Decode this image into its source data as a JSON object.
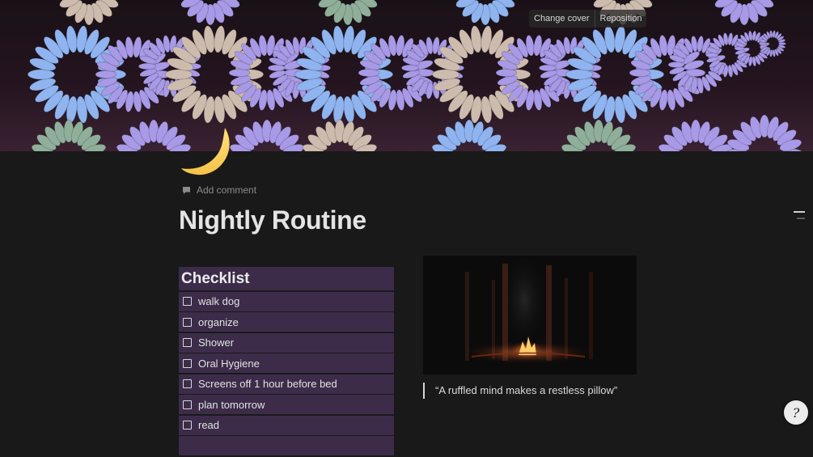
{
  "cover": {
    "change_cover_label": "Change cover",
    "reposition_label": "Reposition",
    "colors": {
      "blue": "#8fb4ef",
      "lavender": "#a89ae6",
      "beige": "#cdbcae",
      "sage": "#8faf9a",
      "bg": "#1d1219"
    }
  },
  "page": {
    "icon": "crescent-moon-icon",
    "add_comment_label": "Add comment",
    "title": "Nightly Routine"
  },
  "checklist": {
    "heading": "Checklist",
    "items": [
      {
        "label": "walk dog",
        "checked": false
      },
      {
        "label": "organize",
        "checked": false
      },
      {
        "label": "Shower",
        "checked": false
      },
      {
        "label": "Oral Hygiene",
        "checked": false
      },
      {
        "label": "Screens off 1 hour before bed",
        "checked": false
      },
      {
        "label": "plan tomorrow",
        "checked": false
      },
      {
        "label": "read",
        "checked": false
      }
    ],
    "colors": {
      "row_bg": "#3c2c4a"
    }
  },
  "media": {
    "image_subject": "campfire-in-dark-forest",
    "quote": "“A ruffled mind makes a restless pillow”"
  },
  "help": {
    "icon": "help-icon",
    "glyph": "?"
  }
}
